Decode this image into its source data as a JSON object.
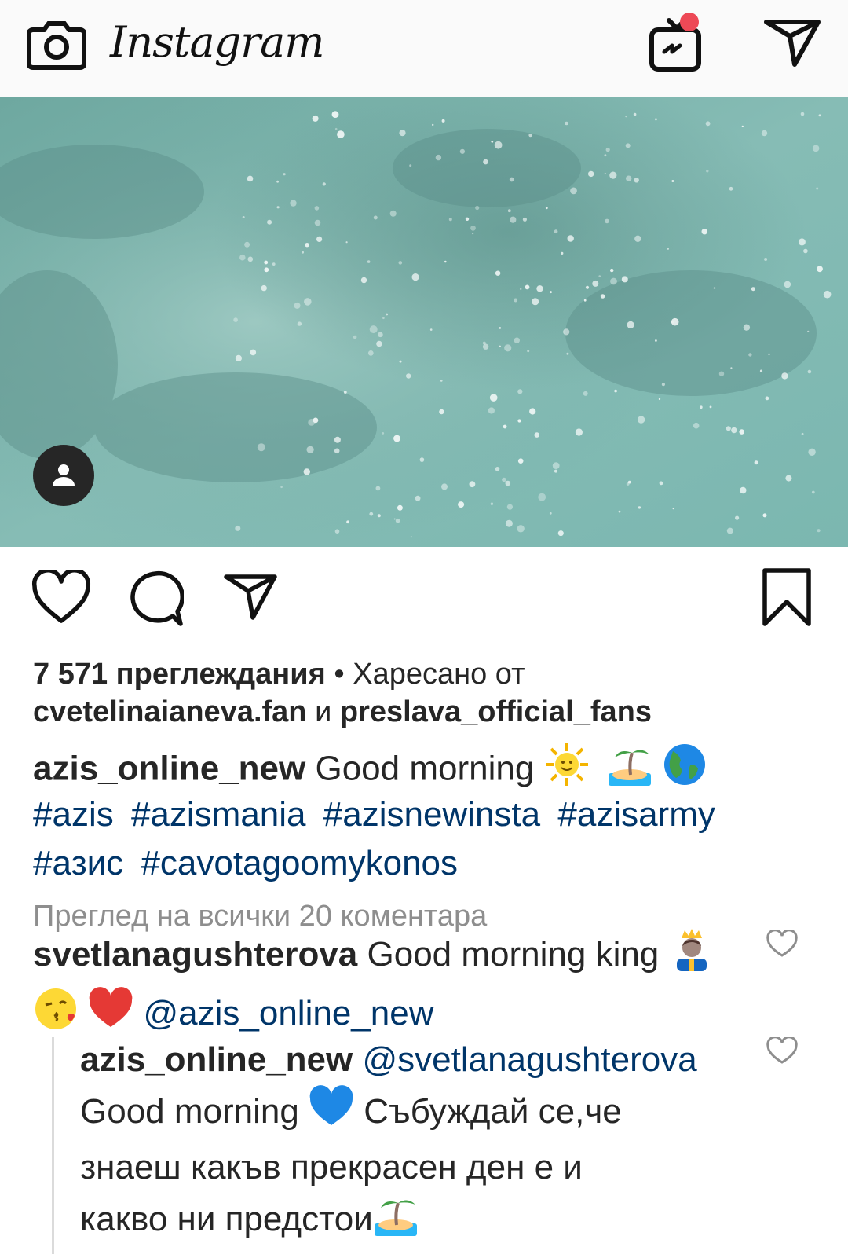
{
  "app": {
    "brand": "Instagram",
    "icons": {
      "camera": "camera-icon",
      "igtv": "igtv-icon",
      "direct": "direct-send-icon"
    },
    "igtv_badge_color": "#ed4956"
  },
  "post": {
    "tag_icon": "person-icon",
    "views": "7 571 преглеждания",
    "separator": "•",
    "liked_by_prefix": "Харесано от",
    "liker1": "cvetelinaianeva.fan",
    "and_word": "и",
    "liker2": "preslava_official_fans",
    "author": "azis_online_new",
    "caption": "Good morning",
    "caption_emojis": [
      "sun-with-face",
      "desert-island",
      "globe-americas"
    ],
    "hashtags": [
      "#azis",
      "#azismania",
      "#azisnewinsta",
      "#azisarmy",
      "#азис",
      "#cavotagoomykonos"
    ],
    "view_all_comments": "Преглед на всички 20 коментара"
  },
  "comments": [
    {
      "user": "svetlanagushterova",
      "text": "Good morning king",
      "emojis_after_text": [
        "prince"
      ],
      "emojis_line2": [
        "kissing-face",
        "red-heart"
      ],
      "mention": "@azis_online_new"
    },
    {
      "user": "azis_online_new",
      "mention": "@svetlanagushterova",
      "text_part1": "Good morning",
      "emoji": "blue-heart",
      "text_part2": "Събуждай се,че",
      "text_line3": "знаеш какъв прекрасен ден е и",
      "text_line4": "какво ни предстои",
      "end_emoji": "desert-island"
    }
  ],
  "colors": {
    "link": "#003569",
    "muted": "#8e8e8e",
    "text": "#262626"
  }
}
